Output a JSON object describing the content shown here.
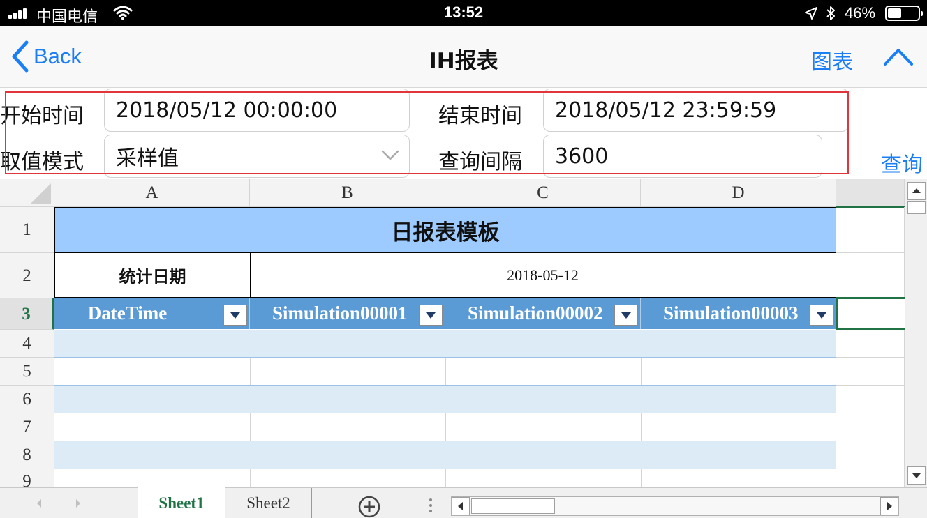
{
  "status_bar": {
    "carrier": "中国电信",
    "time": "13:52",
    "battery_percent": "46%",
    "battery_level": 0.46,
    "icons": [
      "signal-icon",
      "wifi-icon",
      "location-icon",
      "bluetooth-icon",
      "battery-icon"
    ]
  },
  "nav": {
    "back_label": "Back",
    "title": "IH报表",
    "chart_label": "图表",
    "collapse_icon": "chevron-up-icon"
  },
  "form": {
    "start_label": "开始时间",
    "start_value": "2018/05/12 00:00:00",
    "end_label": "结束时间",
    "end_value": "2018/05/12 23:59:59",
    "mode_label": "取值模式",
    "mode_value": "采样值",
    "interval_label": "查询间隔",
    "interval_value": "3600",
    "query_label": "查询",
    "highlight_color": "#e0353b"
  },
  "sheet": {
    "columns": [
      "A",
      "B",
      "C",
      "D"
    ],
    "rows": [
      "1",
      "2",
      "3",
      "4",
      "5",
      "6",
      "7",
      "8",
      "9"
    ],
    "title": "日报表模板",
    "date_label": "统计日期",
    "date_value": "2018-05-12",
    "headers": [
      "DateTime",
      "Simulation00001",
      "Simulation00002",
      "Simulation00003"
    ],
    "colors": {
      "title_bg": "#9dcbff",
      "header_bg": "#5b9bd5",
      "band_bg": "#ddebf7",
      "selection": "#217346"
    }
  },
  "tabs": {
    "items": [
      "Sheet1",
      "Sheet2"
    ],
    "active": "Sheet1"
  }
}
